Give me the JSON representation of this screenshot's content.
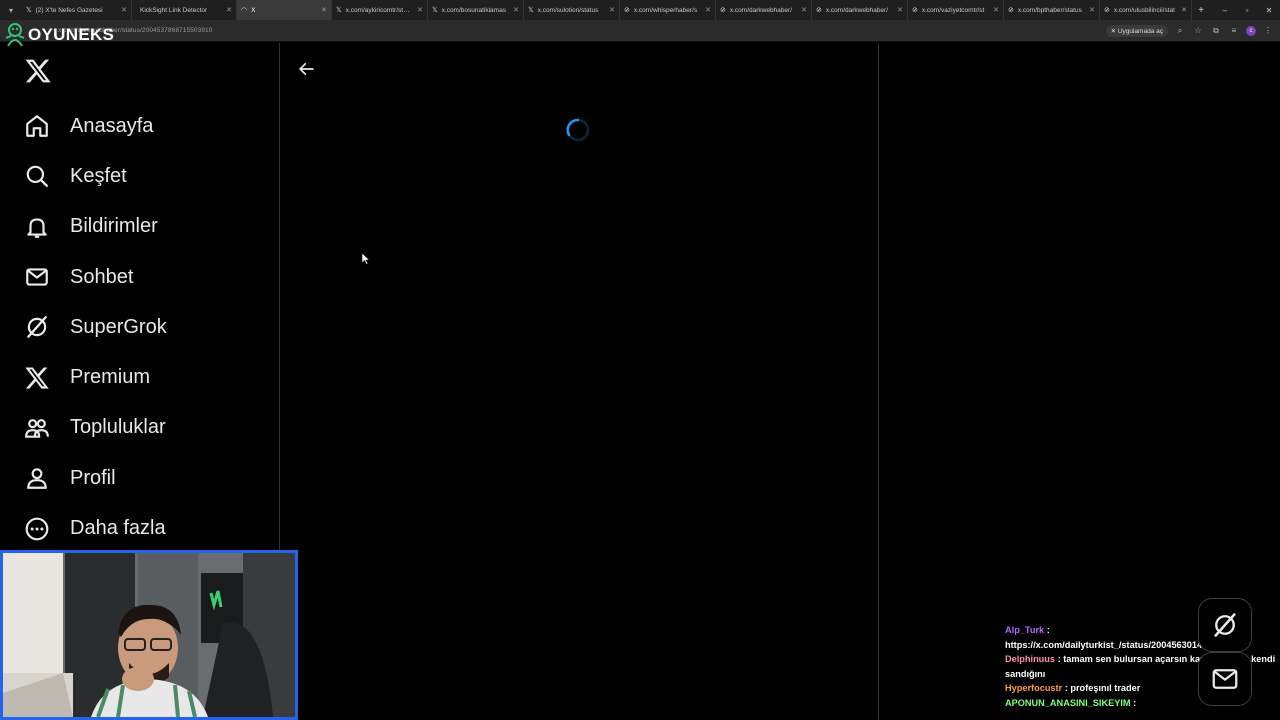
{
  "browser": {
    "tabs": [
      {
        "label": "(2) X'te Nefes Gazetesi",
        "icon": "x-favicon",
        "active": false
      },
      {
        "label": "KickSight Link Detector",
        "icon": "blank",
        "active": false
      },
      {
        "label": "X",
        "icon": "loading",
        "active": true
      },
      {
        "label": "x.com/aykiricomtr/status",
        "icon": "x-favicon",
        "active": false
      },
      {
        "label": "x.com/bosunatiklamas",
        "icon": "x-favicon",
        "active": false
      },
      {
        "label": "x.com/sulotion/status",
        "icon": "x-favicon",
        "active": false
      },
      {
        "label": "x.com/whisperhaber/s",
        "icon": "link-icon",
        "active": false
      },
      {
        "label": "x.com/darkwebhaber/",
        "icon": "link-icon",
        "active": false
      },
      {
        "label": "x.com/darkwebhaber/",
        "icon": "link-icon",
        "active": false
      },
      {
        "label": "x.com/vaziyetcomtr/st",
        "icon": "link-icon",
        "active": false
      },
      {
        "label": "x.com/bpthaber/status",
        "icon": "link-icon",
        "active": false
      },
      {
        "label": "x.com/ulusbilincii/stat",
        "icon": "link-icon",
        "active": false
      }
    ],
    "url": "x.com/darkwebhaber/status/2004537868715503910",
    "open_in_app": "Uygulamada aç",
    "profile_initial": "c"
  },
  "logo": {
    "text": "OYUNEKS"
  },
  "sidebar": {
    "items": [
      {
        "label": "Anasayfa",
        "icon": "home-icon"
      },
      {
        "label": "Keşfet",
        "icon": "search-icon"
      },
      {
        "label": "Bildirimler",
        "icon": "bell-icon"
      },
      {
        "label": "Sohbet",
        "icon": "mail-icon"
      },
      {
        "label": "SuperGrok",
        "icon": "grok-icon"
      },
      {
        "label": "Premium",
        "icon": "x-icon"
      },
      {
        "label": "Topluluklar",
        "icon": "people-icon"
      },
      {
        "label": "Profil",
        "icon": "person-icon"
      },
      {
        "label": "Daha fazla",
        "icon": "more-icon"
      }
    ]
  },
  "chat": {
    "messages": [
      {
        "user": "Alp_Turk",
        "color": "#b36bff",
        "text": "https://x.com/dailyturkist_/status/2004563014289146033"
      },
      {
        "user": "Delphinuus",
        "color": "#ff8fb1",
        "text": "tamam sen bulursan açarsın kardeşim sen kendi sandığını"
      },
      {
        "user": "Hyperfocustr",
        "color": "#ff9b3d",
        "text": "profeşınıl trader"
      },
      {
        "user": "APONUN_ANASINI_SIKEYIM",
        "color": "#7dff7d",
        "text": ""
      }
    ]
  },
  "colors": {
    "accent": "#1d9bf0",
    "border": "#2f3336",
    "webcam_border": "#2563eb"
  }
}
